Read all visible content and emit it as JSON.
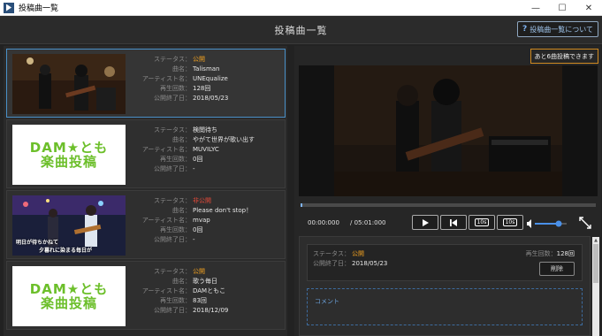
{
  "window": {
    "title": "投稿曲一覧",
    "minimize": "—",
    "maximize": "☐",
    "close": "✕"
  },
  "header": {
    "title": "投稿曲一覧",
    "about_label": "投稿曲一覧について"
  },
  "labels": {
    "status": "ステータス：",
    "song": "曲名：",
    "artist": "アーティスト名：",
    "plays": "再生回数：",
    "end_date": "公開終了日："
  },
  "songs": [
    {
      "status": "公開",
      "song": "Talisman",
      "artist": "UNEqualize",
      "plays": "128回",
      "end_date": "2018/05/23"
    },
    {
      "status": "検閲待ち",
      "song": "やがて世界が歌い出す",
      "artist": "MUVILYC",
      "plays": "0回",
      "end_date": "-"
    },
    {
      "status": "非公開",
      "song": "Please don't stop！",
      "artist": "mvap",
      "plays": "0回",
      "end_date": "-"
    },
    {
      "status": "公開",
      "song": "歌う毎日",
      "artist": "DAMともこ",
      "plays": "83回",
      "end_date": "2018/12/09"
    }
  ],
  "dam_logo": {
    "line1": "DAM★とも",
    "line2": "楽曲投稿"
  },
  "thumb_caption": {
    "line1": "明日が待ちかねて",
    "line2": "夕暮れに染まる毎日が"
  },
  "player": {
    "upload_label": "あと6曲投稿できます",
    "current_time": "00:00:000",
    "total_time": "/ 05:01:000",
    "rewind_label": "10s",
    "forward_label": "10s",
    "progress_fraction": 0.005,
    "volume_fraction": 0.75
  },
  "detail": {
    "status_label": "ステータス：",
    "status_value": "公開",
    "end_label": "公開終了日：",
    "end_value": "2018/05/23",
    "plays_label": "再生回数：",
    "plays_value": "128回",
    "delete_label": "削除",
    "comment_label": "コメント"
  },
  "colors": {
    "accent_blue": "#4a90c8",
    "public": "#f0a020",
    "private": "#e54a3a",
    "dam_green": "#6cbf2a"
  }
}
